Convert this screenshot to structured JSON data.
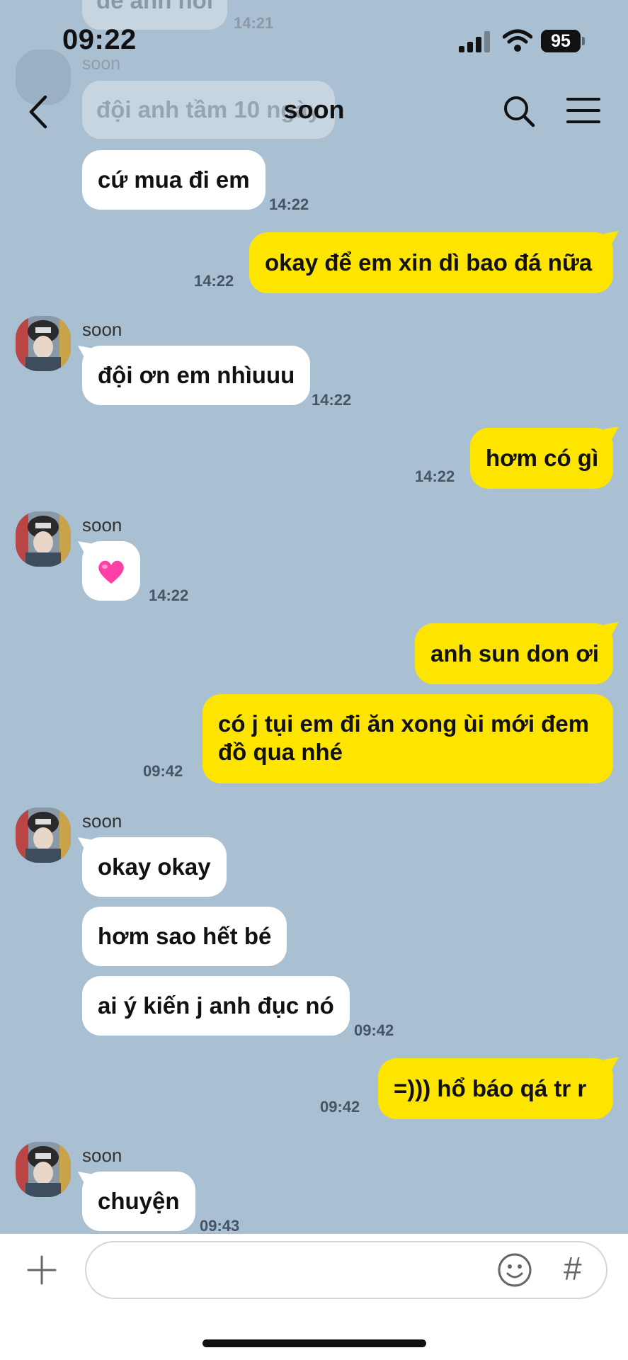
{
  "status_bar": {
    "time": "09:22",
    "battery": "95"
  },
  "header": {
    "title": "soon"
  },
  "ghost": {
    "top_text": "để anh nói",
    "top_time": "14:21",
    "sender": "soon",
    "bubble_text": "đội anh tầm 10 ngày"
  },
  "messages": [
    {
      "id": "m1",
      "side": "in",
      "text": "cứ mua đi em",
      "time": "14:22"
    },
    {
      "id": "m2",
      "side": "out",
      "text": "okay để em xin dì bao đá nữa",
      "time": "14:22"
    },
    {
      "id": "m3",
      "side": "in",
      "sender": "soon",
      "text": "đội ơn em nhìuuu",
      "time": "14:22"
    },
    {
      "id": "m4",
      "side": "out",
      "text": "hơm có gì",
      "time": "14:22"
    },
    {
      "id": "m5",
      "side": "in",
      "sender": "soon",
      "text": "💗",
      "time": "14:22"
    },
    {
      "id": "m6",
      "side": "out",
      "text": "anh sun don ơi"
    },
    {
      "id": "m7",
      "side": "out",
      "text_line1": "có j tụi em đi ăn xong ùi mới đem",
      "text_line2": "đồ qua nhé",
      "time": "09:42"
    },
    {
      "id": "m8",
      "side": "in",
      "sender": "soon",
      "text": "okay okay"
    },
    {
      "id": "m9",
      "side": "in",
      "text": "hơm sao hết bé"
    },
    {
      "id": "m10",
      "side": "in",
      "text": "ai ý kiến j anh đục nó",
      "time": "09:42"
    },
    {
      "id": "m11",
      "side": "out",
      "text": "=))) hổ báo qá tr r",
      "time": "09:42"
    },
    {
      "id": "m12",
      "side": "in",
      "sender": "soon",
      "text": "chuyện",
      "time": "09:43"
    }
  ],
  "input": {
    "placeholder": "",
    "hash_label": "#"
  },
  "colors": {
    "background": "#a9bfd2",
    "outgoing": "#fee500",
    "incoming": "#ffffff"
  }
}
